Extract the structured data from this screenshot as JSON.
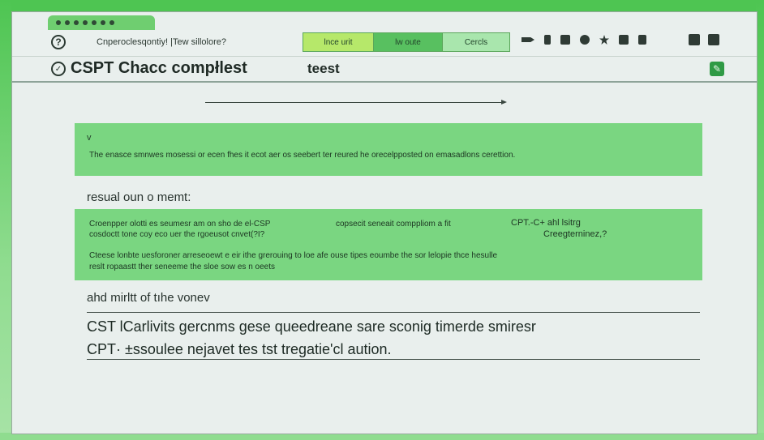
{
  "window": {
    "toolbar_prompt": "Cnperoclesqontiy! |Tew sillolore?",
    "segments": [
      "lnce urit",
      "lw oute",
      "Cercls"
    ],
    "title": "CSPT Chacc compłlest",
    "title_suffix": "teest"
  },
  "panel1": {
    "chevron": "v",
    "text": "The enasce smnwes mosessi or ecen fhes it ecot aer os seebert ter reured he orecelpposted on emasadlons cerettion."
  },
  "section_label": "resual oun o memt:",
  "panel2": {
    "line1": "Croenpper olotti es seumesr am on sho de el-CSP",
    "line1_mid": "copsecit seneait comppliom a fit",
    "tag": "CPT.-C+ ahl lsitrg",
    "line2": "cosdoctt tone coy eco uer the rgoeusot cnvet(?I?",
    "tag2": "Creegterninez,?",
    "line3": "Cteese lonbte uesforoner arreseoewt e eir ithe grerouing to loe afe ouse tipes eoumbe the sor lelopie thce hesulle",
    "line4": "reslt ropaastt ther seneeme the sloe sow es n oeets"
  },
  "sub_heading": "ahd mirltt of tıhe vonev",
  "lines": {
    "line1": "CST lCarlivits gercnms gese queedreane sare sconig timerde smiresr",
    "line2": "CPT· ±ssoulee nejavet tes tst tregatie'cl aution."
  },
  "colors": {
    "frame": "#4ec552",
    "panel": "#7ad681",
    "accent": "#2f9a45"
  }
}
